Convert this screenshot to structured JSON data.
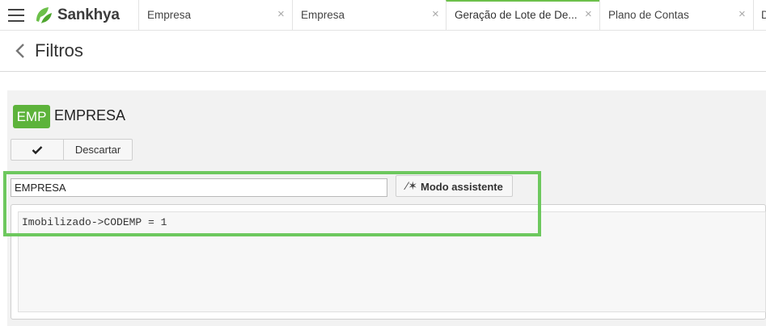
{
  "app": {
    "brand": "Sankhya",
    "accent": "#6cc04a"
  },
  "tabs": [
    {
      "label": "Empresa",
      "active": false
    },
    {
      "label": "Empresa",
      "active": false
    },
    {
      "label": "Geração de Lote de De...",
      "active": true
    },
    {
      "label": "Plano de Contas",
      "active": false
    },
    {
      "label": "D",
      "active": false
    }
  ],
  "header": {
    "title": "Filtros"
  },
  "filter": {
    "badge": "EMP",
    "title": "EMPRESA",
    "discard_label": "Descartar",
    "name_value": "EMPRESA",
    "assist_label": "Modo assistente",
    "expression": "Imobilizado->CODEMP = 1"
  },
  "icons": {
    "menu": "hamburger-menu-icon",
    "back": "chevron-left-icon",
    "confirm": "check-icon",
    "assist": "magic-wand-icon",
    "close": "close-icon"
  }
}
